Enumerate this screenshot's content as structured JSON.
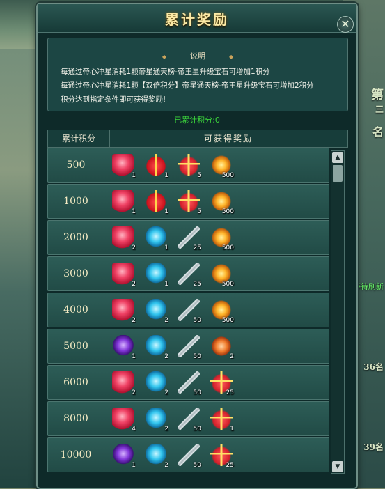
{
  "window": {
    "title": "累计奖励",
    "close_label": "✕"
  },
  "background": {
    "side_char_1": "第",
    "side_char_2": "三",
    "side_char_3": "名",
    "side_refresh": "等待刷新",
    "side_rank_a": "36名",
    "side_rank_b": "39名"
  },
  "description": {
    "heading": "说明",
    "lines": [
      "每通过帝心冲星消耗1颗帝星通天榜-帝王星升级宝石可增加1积分",
      "每通过帝心冲星消耗1颗【双倍积分】帝星通天榜-帝王星升级宝石可增加2积分",
      "积分达到指定条件即可获得奖励!"
    ]
  },
  "score": {
    "label": "已累计积分:",
    "value": "0"
  },
  "table": {
    "col_score": "累计积分",
    "col_rewards": "可获得奖励"
  },
  "rows": [
    {
      "score": "500",
      "items": [
        {
          "icon": "red-gem",
          "qty": "1"
        },
        {
          "icon": "gift",
          "qty": "1"
        },
        {
          "icon": "gift-box",
          "qty": "5"
        },
        {
          "icon": "gold-orb",
          "qty": "500"
        }
      ]
    },
    {
      "score": "1000",
      "items": [
        {
          "icon": "red-gem",
          "qty": "1"
        },
        {
          "icon": "gift",
          "qty": "1"
        },
        {
          "icon": "gift-box",
          "qty": "5"
        },
        {
          "icon": "gold-orb",
          "qty": "500"
        }
      ]
    },
    {
      "score": "2000",
      "items": [
        {
          "icon": "red-gem",
          "qty": "2"
        },
        {
          "icon": "blue-crystal",
          "qty": "1"
        },
        {
          "icon": "sword",
          "qty": "25"
        },
        {
          "icon": "gold-orb",
          "qty": "500"
        }
      ]
    },
    {
      "score": "3000",
      "items": [
        {
          "icon": "red-gem",
          "qty": "2"
        },
        {
          "icon": "blue-crystal",
          "qty": "1"
        },
        {
          "icon": "sword",
          "qty": "25"
        },
        {
          "icon": "gold-orb",
          "qty": "500"
        }
      ]
    },
    {
      "score": "4000",
      "items": [
        {
          "icon": "red-gem",
          "qty": "2"
        },
        {
          "icon": "blue-crystal",
          "qty": "2"
        },
        {
          "icon": "sword",
          "qty": "50"
        },
        {
          "icon": "gold-orb",
          "qty": "500"
        }
      ]
    },
    {
      "score": "5000",
      "items": [
        {
          "icon": "purple-gem",
          "qty": "1"
        },
        {
          "icon": "blue-crystal",
          "qty": "2"
        },
        {
          "icon": "sword",
          "qty": "50"
        },
        {
          "icon": "orange-stone",
          "qty": "2"
        }
      ]
    },
    {
      "score": "6000",
      "items": [
        {
          "icon": "red-gem",
          "qty": "2"
        },
        {
          "icon": "blue-crystal",
          "qty": "2"
        },
        {
          "icon": "sword",
          "qty": "50"
        },
        {
          "icon": "gift-box",
          "qty": "25"
        }
      ]
    },
    {
      "score": "8000",
      "items": [
        {
          "icon": "red-gem",
          "qty": "4"
        },
        {
          "icon": "blue-crystal",
          "qty": "2"
        },
        {
          "icon": "sword",
          "qty": "50"
        },
        {
          "icon": "gift-box",
          "qty": "1"
        }
      ]
    },
    {
      "score": "10000",
      "items": [
        {
          "icon": "purple-gem",
          "qty": "1"
        },
        {
          "icon": "blue-crystal",
          "qty": "2"
        },
        {
          "icon": "sword",
          "qty": "50"
        },
        {
          "icon": "gift-box",
          "qty": "25"
        }
      ]
    }
  ],
  "scrollbar": {
    "up_label": "▲",
    "down_label": "▼"
  }
}
